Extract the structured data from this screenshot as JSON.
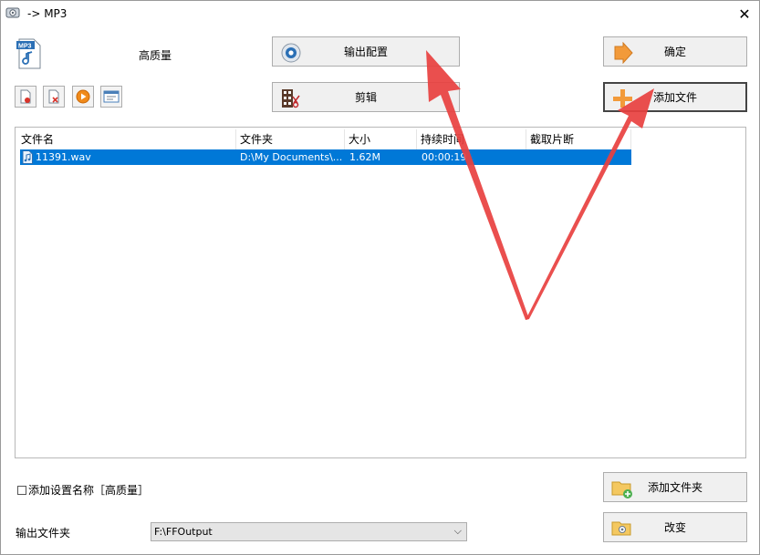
{
  "window": {
    "title": "-> MP3",
    "close_glyph": "✕"
  },
  "profile": {
    "icon": "mp3-file-icon",
    "quality": "高质量"
  },
  "buttons": {
    "output_config": "输出配置",
    "ok": "确定",
    "edit": "剪辑",
    "add_file": "添加文件",
    "add_folder": "添加文件夹",
    "change": "改变"
  },
  "toolbar_icons": [
    "remove-file-icon",
    "clear-list-icon",
    "play-icon",
    "media-info-icon"
  ],
  "file_list": {
    "columns": [
      "文件名",
      "文件夹",
      "大小",
      "持续时间",
      "截取片断"
    ],
    "rows": [
      {
        "name": "11391.wav",
        "folder": "D:\\My Documents\\...",
        "size": "1.62M",
        "duration": "00:00:19",
        "clip": ""
      }
    ]
  },
  "options": {
    "add_setting_name_label": "添加设置名称［高质量］",
    "add_setting_name_checked": false
  },
  "output": {
    "label": "输出文件夹",
    "folder": "F:\\FFOutput"
  },
  "colors": {
    "selection": "#0078d7",
    "annotation_arrow": "#e8403f",
    "button_face": "#f0f0f0"
  }
}
